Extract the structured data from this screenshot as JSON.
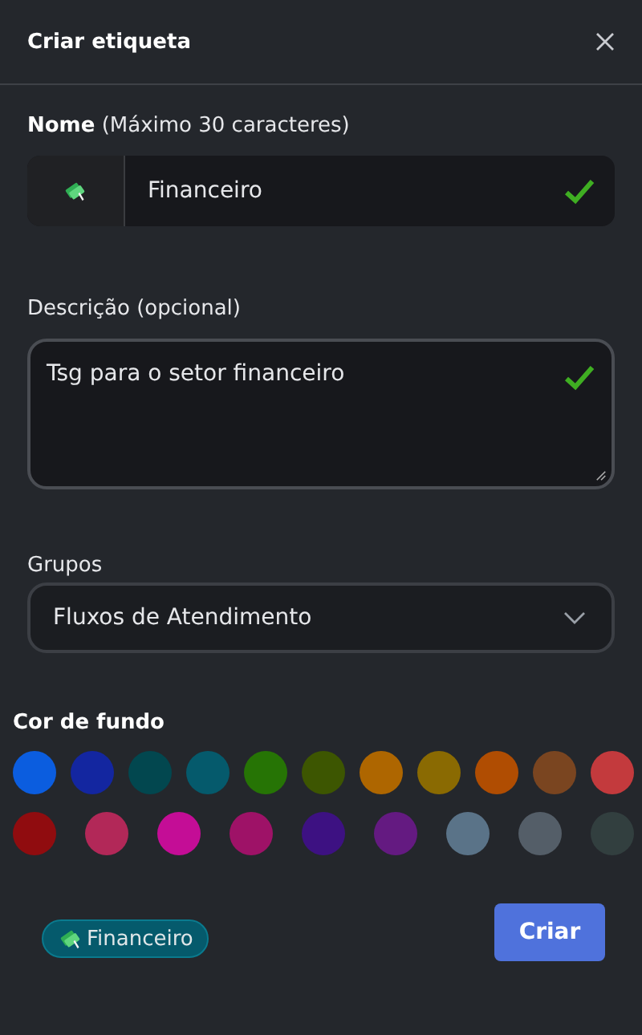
{
  "window": {
    "title": "Criar etiqueta"
  },
  "name_field": {
    "label_bold": "Nome",
    "label_hint": "(Máximo 30 caracteres)",
    "value": "Financeiro",
    "valid": true
  },
  "description_field": {
    "label": "Descrição (opcional)",
    "value": "Tsg para o setor financeiro",
    "valid": true
  },
  "groups_field": {
    "label": "Grupos",
    "value": "Fluxos de Atendimento"
  },
  "background_color": {
    "label": "Cor de fundo",
    "rows": [
      {
        "swatches": [
          {
            "color": "#0b5ddf"
          },
          {
            "color": "#1326a0"
          },
          {
            "color": "#02474f"
          },
          {
            "color": "#055a6c"
          },
          {
            "color": "#267405"
          },
          {
            "color": "#3d5601"
          },
          {
            "color": "#ae6600"
          },
          {
            "color": "#8a6a02"
          },
          {
            "color": "#b04d02"
          },
          {
            "color": "#7a4520"
          },
          {
            "color": "#c33a3d"
          }
        ]
      },
      {
        "swatches": [
          {
            "color": "#900c0f"
          },
          {
            "color": "#b22858"
          },
          {
            "color": "#c40d96"
          },
          {
            "color": "#9e1267"
          },
          {
            "color": "#3d1182"
          },
          {
            "color": "#641a81"
          },
          {
            "color": "#5a7388"
          },
          {
            "color": "#545e68"
          },
          {
            "color": "#323f3f"
          }
        ]
      }
    ]
  },
  "preview": {
    "label": "Financeiro",
    "color": "#055a6c"
  },
  "buttons": [
    "Criar"
  ]
}
